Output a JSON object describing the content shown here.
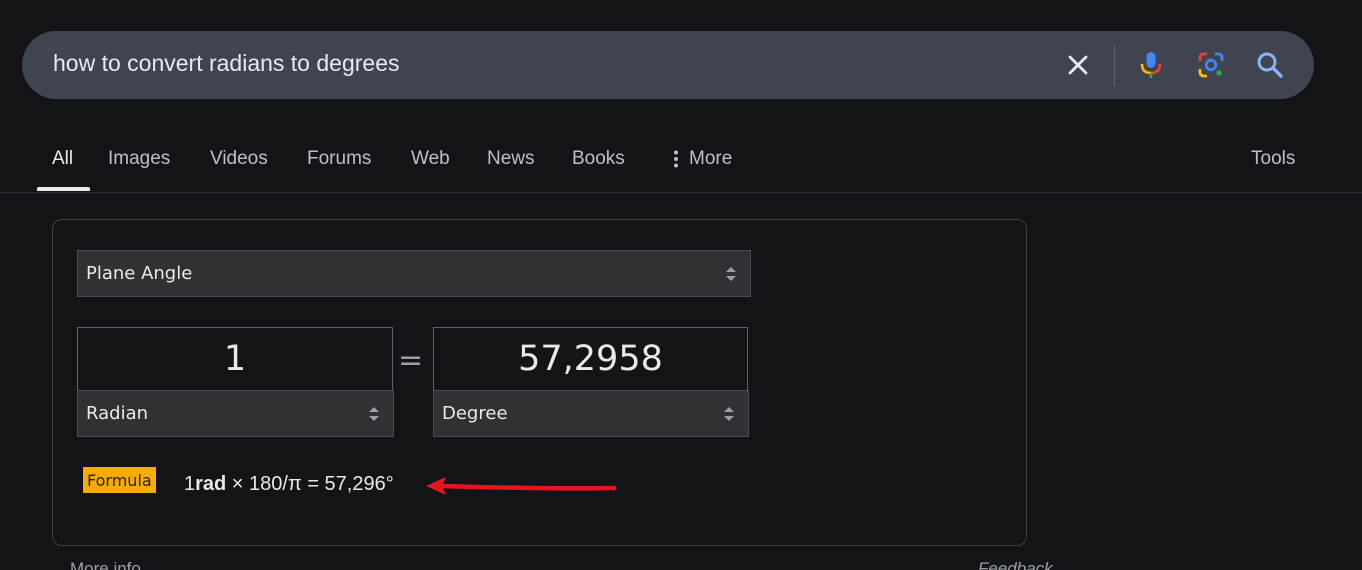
{
  "search": {
    "query": "how to convert radians to degrees",
    "icons": [
      "close-icon",
      "mic-icon",
      "lens-icon",
      "search-icon"
    ]
  },
  "tabs": {
    "items": [
      {
        "label": "All",
        "active": true
      },
      {
        "label": "Images"
      },
      {
        "label": "Videos"
      },
      {
        "label": "Forums"
      },
      {
        "label": "Web"
      },
      {
        "label": "News"
      },
      {
        "label": "Books"
      },
      {
        "label": "More",
        "icon": "more-vert-icon"
      }
    ],
    "tools": "Tools"
  },
  "converter": {
    "category": "Plane Angle",
    "from_value": "1",
    "equals": "=",
    "to_value": "57,2958",
    "from_unit": "Radian",
    "to_unit": "Degree",
    "formula_label": "Formula",
    "formula": {
      "num": "1",
      "unit": "rad",
      "rest": " × 180/π = 57,296°"
    }
  },
  "footer": {
    "more_info": "More info",
    "feedback": "Feedback"
  },
  "colors": {
    "background": "#131418",
    "search_bar": "#404451",
    "formula_badge": "#f9ab00",
    "annotation_arrow": "#e8141c"
  }
}
